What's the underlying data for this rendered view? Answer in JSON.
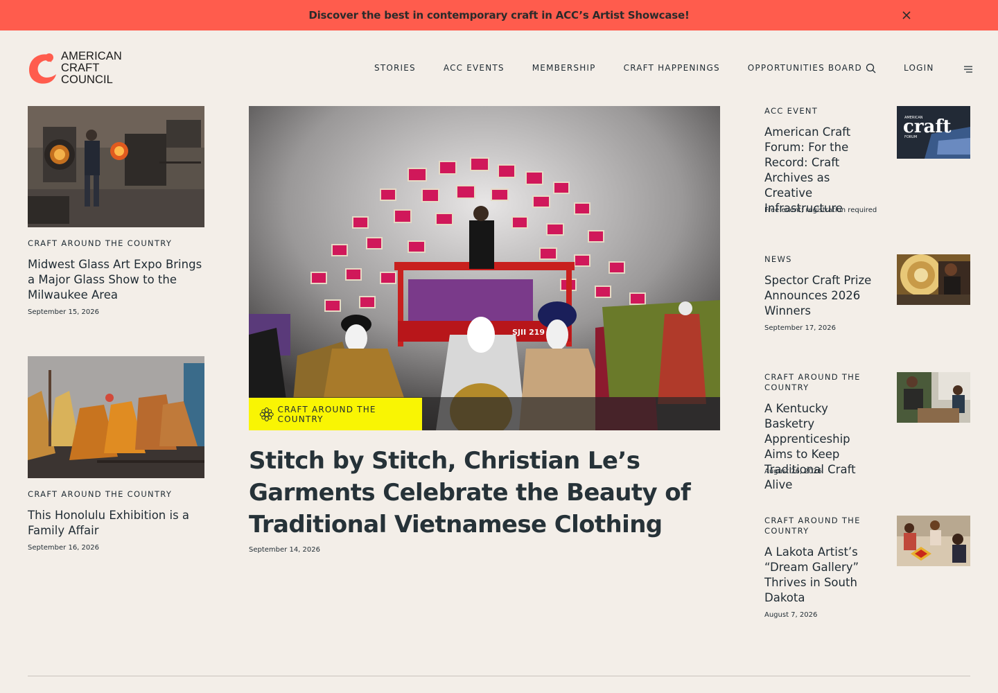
{
  "banner": {
    "text": "Discover the best in contemporary craft in ACC’s Artist Showcase!",
    "close_icon": "close-icon",
    "color": "#ff5c4d"
  },
  "logo": {
    "line1": "AMERICAN",
    "line2": "CRAFT",
    "line3": "COUNCIL",
    "color": "#ff5c4d"
  },
  "nav": {
    "items": [
      "STORIES",
      "ACC EVENTS",
      "MEMBERSHIP",
      "CRAFT HAPPENINGS",
      "OPPORTUNITIES BOARD"
    ],
    "search_icon": "search-icon",
    "login": "LOGIN",
    "menu_icon": "menu-icon"
  },
  "left_stories": [
    {
      "eyebrow": "CRAFT AROUND THE COUNTRY",
      "title": "Midwest Glass Art Expo Brings a Major Glass Show to the Milwaukee Area",
      "date": "September 15, 2026"
    },
    {
      "eyebrow": "CRAFT AROUND THE COUNTRY",
      "title": "This Honolulu Exhibition is a Family Affair",
      "date": "September 16, 2026"
    }
  ],
  "feature": {
    "tag": "CRAFT AROUND THE COUNTRY",
    "tag_color": "#f9f503",
    "title": "Stitch by Stitch, Christian Le’s Garments Celebrate the Beauty of Traditional Vietnamese Clothing",
    "date": "September 14, 2026",
    "image_text": "SJII 219"
  },
  "right_stories": [
    {
      "eyebrow": "ACC EVENT",
      "title": "American Craft Forum: For the Record: Craft Archives as Creative Infrastructure",
      "date": "Free event; registration required",
      "thumb_text_small": "AMERICAN",
      "thumb_text_big": "craft",
      "thumb_text_sub": "FORUM"
    },
    {
      "eyebrow": "NEWS",
      "title": "Spector Craft Prize Announces 2026 Winners",
      "date": "September 17, 2026"
    },
    {
      "eyebrow": "CRAFT AROUND THE COUNTRY",
      "title": "A Kentucky Basketry Apprenticeship Aims to Keep Traditional Craft Alive",
      "date": "August 26, 2026"
    },
    {
      "eyebrow": "CRAFT AROUND THE COUNTRY",
      "title": "A Lakota Artist’s “Dream Gallery” Thrives in South Dakota",
      "date": "August 7, 2026"
    }
  ]
}
